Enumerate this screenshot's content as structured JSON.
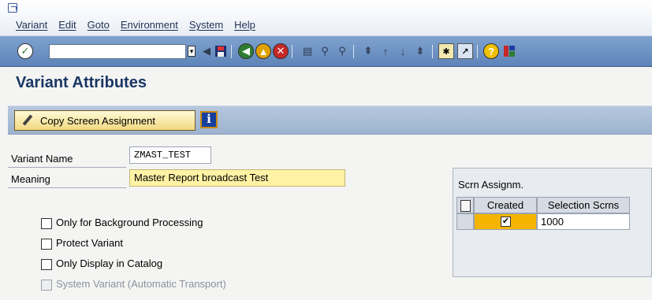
{
  "menubar": {
    "items": [
      "Variant",
      "Edit",
      "Goto",
      "Environment",
      "System",
      "Help"
    ]
  },
  "toolbar": {
    "command_value": "",
    "icons": [
      "enter-icon",
      "save-icon",
      "back-icon",
      "exit-icon",
      "cancel-icon",
      "print-icon",
      "find-icon",
      "find-next-icon",
      "first-page-icon",
      "previous-page-icon",
      "next-page-icon",
      "last-page-icon",
      "new-session-icon",
      "shortcut-icon",
      "help-icon",
      "layout-icon"
    ]
  },
  "page_title": "Variant Attributes",
  "app_toolbar": {
    "copy_button_label": "Copy Screen Assignment",
    "info_button_label": "i"
  },
  "form": {
    "variant_name_label": "Variant Name",
    "variant_name_value": "ZMAST_TEST",
    "meaning_label": "Meaning",
    "meaning_value": "Master Report broadcast Test",
    "options": [
      {
        "label": "Only for Background Processing",
        "checked": false,
        "disabled": false
      },
      {
        "label": "Protect Variant",
        "checked": false,
        "disabled": false
      },
      {
        "label": "Only Display in Catalog",
        "checked": false,
        "disabled": false
      },
      {
        "label": "System Variant (Automatic Transport)",
        "checked": false,
        "disabled": true
      }
    ]
  },
  "screen_assignment": {
    "title": "Scrn Assignm.",
    "columns": [
      "Created",
      "Selection Scrns"
    ],
    "rows": [
      {
        "created": "✔",
        "screen": "1000"
      }
    ]
  },
  "colors": {
    "toolbar_blue": "#6e93c4",
    "title_blue": "#1a3763",
    "required_field_yellow": "#fff2a5"
  }
}
